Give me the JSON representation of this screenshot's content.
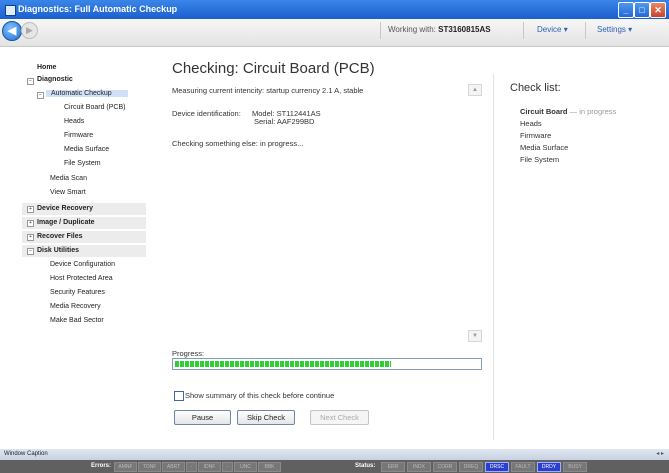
{
  "window": {
    "title": "Diagnostics: Full Automatic Checkup",
    "min_glyph": "_",
    "max_glyph": "□",
    "close_glyph": "✕"
  },
  "nav": {
    "back_glyph": "◀",
    "forward_glyph": "▶",
    "working_label": "Working with:",
    "drive_id": "ST3160815AS",
    "device_menu": "Device",
    "settings_menu": "Settings",
    "menu_glyph": "▾"
  },
  "sidebar": {
    "home": "Home",
    "diagnostic": "Diagnostic",
    "automatic_checkup": "Automatic Checkup",
    "checkup_items": [
      "Circuit Board (PCB)",
      "Heads",
      "Firmware",
      "Media Surface",
      "File System"
    ],
    "media_scan": "Media Scan",
    "view_smart": "View Smart",
    "device_recovery": "Device Recovery",
    "image_duplicate": "Image / Duplicate",
    "recover_files": "Recover Files",
    "disk_utilities": "Disk Utilities",
    "disk_utilities_items": [
      "Device Configuration",
      "Host Protected Area",
      "Security Features",
      "Media Recovery",
      "Make Bad Sector"
    ],
    "expand_glyph": "+",
    "collapse_glyph": "−"
  },
  "main": {
    "title": "Checking: Circuit Board (PCB)",
    "intensity": "Measuring current intencity: startup currency 2.1 A, stable",
    "device_id_label": "Device identification:",
    "model": "Model: ST112441AS",
    "serial": "Serial: AAF299BD",
    "checking_else": "Checking something else: in progress...",
    "scroll_up_glyph": "▲",
    "scroll_down_glyph": "▼",
    "progress_label": "Progress:",
    "progress_fraction": 0.71,
    "show_summary": "Show summary of this check before continue",
    "pause": "Pause",
    "skip_check": "Skip Check",
    "next_check": "Next Check"
  },
  "checklist": {
    "title": "Check list:",
    "items": [
      {
        "label": "Circuit Board",
        "status": "— in progress"
      },
      {
        "label": "Heads"
      },
      {
        "label": "Firmware"
      },
      {
        "label": "Media Surface"
      },
      {
        "label": "File System"
      }
    ]
  },
  "caption": {
    "text": "Window Caption",
    "controls": "◂ ▸"
  },
  "statusbar": {
    "errors_label": "Errors:",
    "errors": [
      "AMNF",
      "TONF",
      "ABRT",
      "-",
      "IDNF",
      "-",
      "UNC",
      "BBK"
    ],
    "status_label": "Status:",
    "status": [
      {
        "label": "ERR",
        "on": false
      },
      {
        "label": "INDX",
        "on": false
      },
      {
        "label": "CORR",
        "on": false
      },
      {
        "label": "DREQ",
        "on": false
      },
      {
        "label": "DRSC",
        "on": true
      },
      {
        "label": "FAULT",
        "on": false
      },
      {
        "label": "DRDY",
        "on": true
      },
      {
        "label": "BUSY",
        "on": false
      }
    ]
  }
}
